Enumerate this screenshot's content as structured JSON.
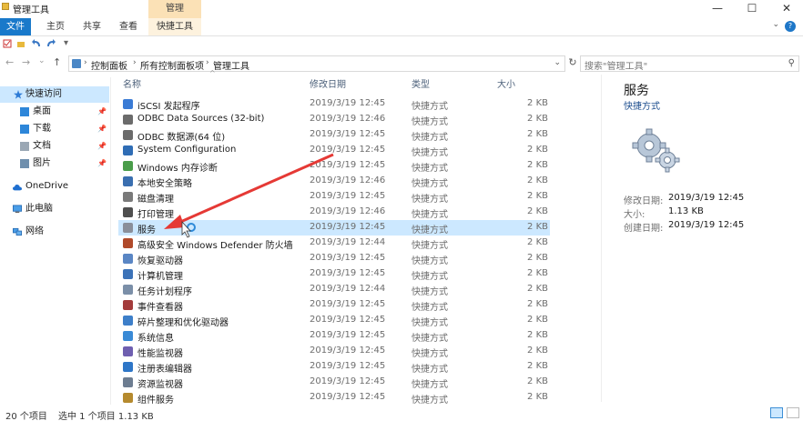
{
  "window": {
    "title": "管理工具",
    "context_tab_group": "管理",
    "minimize_glyph": "—",
    "maximize_glyph": "☐",
    "close_glyph": "✕"
  },
  "ribbon": {
    "tabs": [
      "文件",
      "主页",
      "共享",
      "查看",
      "快捷工具"
    ],
    "help_glyph": "?",
    "collapse_glyph": "⌄"
  },
  "address": {
    "crumbs": [
      "控制面板",
      "所有控制面板项",
      "管理工具"
    ],
    "separator": "›",
    "back_glyph": "←",
    "forward_glyph": "→",
    "recent_glyph": "⌄",
    "up_glyph": "↑",
    "dropdown_glyph": "⌄",
    "refresh_glyph": "↻",
    "search_placeholder": "搜索\"管理工具\"",
    "search_glyph": "⚲"
  },
  "sidebar": {
    "items": [
      {
        "label": "快速访问",
        "icon": "star-icon",
        "pinned": false
      },
      {
        "label": "桌面",
        "icon": "desktop-folder-icon",
        "pinned": true
      },
      {
        "label": "下载",
        "icon": "download-folder-icon",
        "pinned": true
      },
      {
        "label": "文档",
        "icon": "documents-folder-icon",
        "pinned": true
      },
      {
        "label": "图片",
        "icon": "pictures-folder-icon",
        "pinned": true
      },
      {
        "label": "OneDrive",
        "icon": "cloud-icon",
        "pinned": false
      },
      {
        "label": "此电脑",
        "icon": "computer-icon",
        "pinned": false
      },
      {
        "label": "网络",
        "icon": "network-icon",
        "pinned": false
      }
    ],
    "pin_glyph": "📌"
  },
  "columns": {
    "name": "名称",
    "date": "修改日期",
    "type": "类型",
    "size": "大小",
    "sort_caret": "^"
  },
  "files": [
    {
      "name": "iSCSI 发起程序",
      "date": "2019/3/19 12:45",
      "type": "快捷方式",
      "size": "2 KB",
      "color": "#3a7bd5"
    },
    {
      "name": "ODBC Data Sources (32-bit)",
      "date": "2019/3/19 12:46",
      "type": "快捷方式",
      "size": "2 KB",
      "color": "#6b6b6b"
    },
    {
      "name": "ODBC 数据源(64 位)",
      "date": "2019/3/19 12:45",
      "type": "快捷方式",
      "size": "2 KB",
      "color": "#6b6b6b"
    },
    {
      "name": "System Configuration",
      "date": "2019/3/19 12:45",
      "type": "快捷方式",
      "size": "2 KB",
      "color": "#2f6db5"
    },
    {
      "name": "Windows 内存诊断",
      "date": "2019/3/19 12:45",
      "type": "快捷方式",
      "size": "2 KB",
      "color": "#4a9d4a"
    },
    {
      "name": "本地安全策略",
      "date": "2019/3/19 12:46",
      "type": "快捷方式",
      "size": "2 KB",
      "color": "#3a6fb0"
    },
    {
      "name": "磁盘清理",
      "date": "2019/3/19 12:45",
      "type": "快捷方式",
      "size": "2 KB",
      "color": "#7a7a7a"
    },
    {
      "name": "打印管理",
      "date": "2019/3/19 12:46",
      "type": "快捷方式",
      "size": "2 KB",
      "color": "#4f4f4f"
    },
    {
      "name": "服务",
      "date": "2019/3/19 12:45",
      "type": "快捷方式",
      "size": "2 KB",
      "color": "#8a8f9a"
    },
    {
      "name": "高级安全 Windows Defender 防火墙",
      "date": "2019/3/19 12:44",
      "type": "快捷方式",
      "size": "2 KB",
      "color": "#b04a2a"
    },
    {
      "name": "恢复驱动器",
      "date": "2019/3/19 12:45",
      "type": "快捷方式",
      "size": "2 KB",
      "color": "#5a86c4"
    },
    {
      "name": "计算机管理",
      "date": "2019/3/19 12:45",
      "type": "快捷方式",
      "size": "2 KB",
      "color": "#3c73b8"
    },
    {
      "name": "任务计划程序",
      "date": "2019/3/19 12:44",
      "type": "快捷方式",
      "size": "2 KB",
      "color": "#7b8fa8"
    },
    {
      "name": "事件查看器",
      "date": "2019/3/19 12:45",
      "type": "快捷方式",
      "size": "2 KB",
      "color": "#a33b3b"
    },
    {
      "name": "碎片整理和优化驱动器",
      "date": "2019/3/19 12:45",
      "type": "快捷方式",
      "size": "2 KB",
      "color": "#3d7fc9"
    },
    {
      "name": "系统信息",
      "date": "2019/3/19 12:45",
      "type": "快捷方式",
      "size": "2 KB",
      "color": "#3a8ad6"
    },
    {
      "name": "性能监视器",
      "date": "2019/3/19 12:45",
      "type": "快捷方式",
      "size": "2 KB",
      "color": "#6f5fb0"
    },
    {
      "name": "注册表编辑器",
      "date": "2019/3/19 12:45",
      "type": "快捷方式",
      "size": "2 KB",
      "color": "#2e76c7"
    },
    {
      "name": "资源监视器",
      "date": "2019/3/19 12:45",
      "type": "快捷方式",
      "size": "2 KB",
      "color": "#6d7d91"
    },
    {
      "name": "组件服务",
      "date": "2019/3/19 12:45",
      "type": "快捷方式",
      "size": "2 KB",
      "color": "#b58a2e"
    }
  ],
  "selected_index": 8,
  "details": {
    "title": "服务",
    "subtitle": "快捷方式",
    "fields": [
      {
        "k": "修改日期:",
        "v": "2019/3/19 12:45"
      },
      {
        "k": "大小:",
        "v": "1.13 KB"
      },
      {
        "k": "创建日期:",
        "v": "2019/3/19 12:45"
      }
    ]
  },
  "status": {
    "count": "20 个项目",
    "selection": "选中 1 个项目 1.13 KB"
  },
  "colors": {
    "accent": "#1979ca",
    "selection": "#cce8ff",
    "arrow": "#e53935"
  }
}
